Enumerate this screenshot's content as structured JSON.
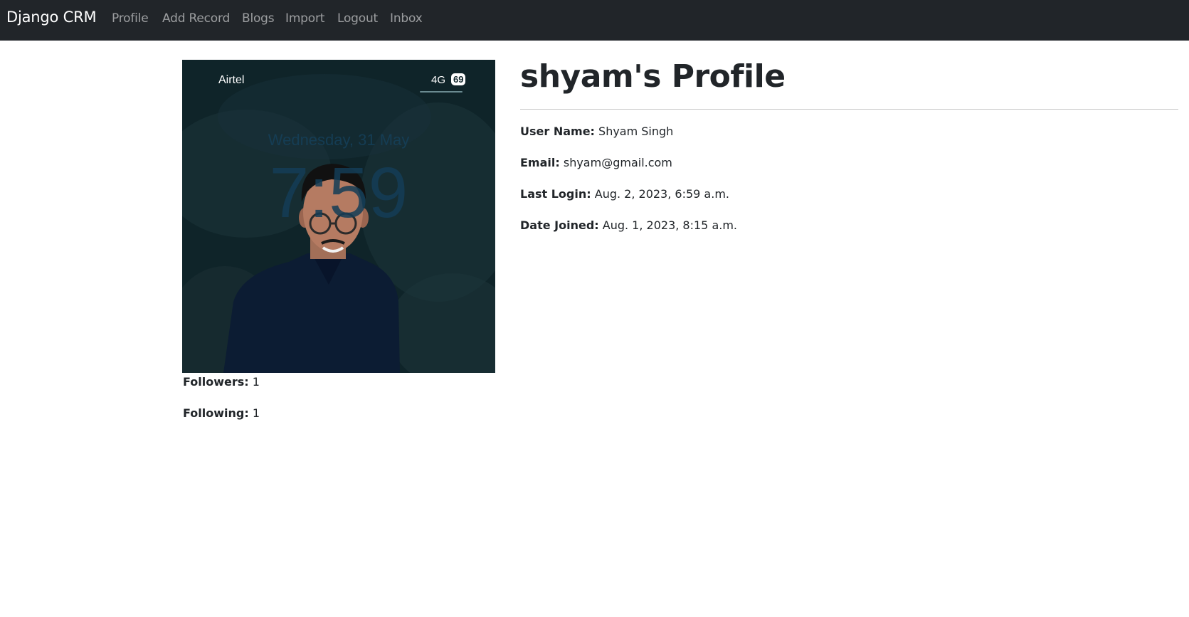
{
  "navbar": {
    "brand": "Django CRM",
    "links": [
      "Profile",
      "Add Record",
      "Blogs",
      "Import",
      "Logout",
      "Inbox"
    ]
  },
  "profile_photo": {
    "carrier": "Airtel",
    "network": "4G",
    "battery": "69",
    "lock_date": "Wednesday, 31 May",
    "lock_time": "7:59"
  },
  "stats": {
    "followers_label": "Followers:",
    "followers_value": "1",
    "following_label": "Following:",
    "following_value": "1"
  },
  "profile": {
    "title": "shyam's Profile",
    "fields": [
      {
        "label": "User Name:",
        "value": "Shyam Singh"
      },
      {
        "label": "Email:",
        "value": "shyam@gmail.com"
      },
      {
        "label": "Last Login:",
        "value": "Aug. 2, 2023, 6:59 a.m."
      },
      {
        "label": "Date Joined:",
        "value": "Aug. 1, 2023, 8:15 a.m."
      }
    ]
  },
  "colors": {
    "navbar_bg": "#212529",
    "nav_link": "rgba(255,255,255,0.55)",
    "text": "#212529"
  }
}
